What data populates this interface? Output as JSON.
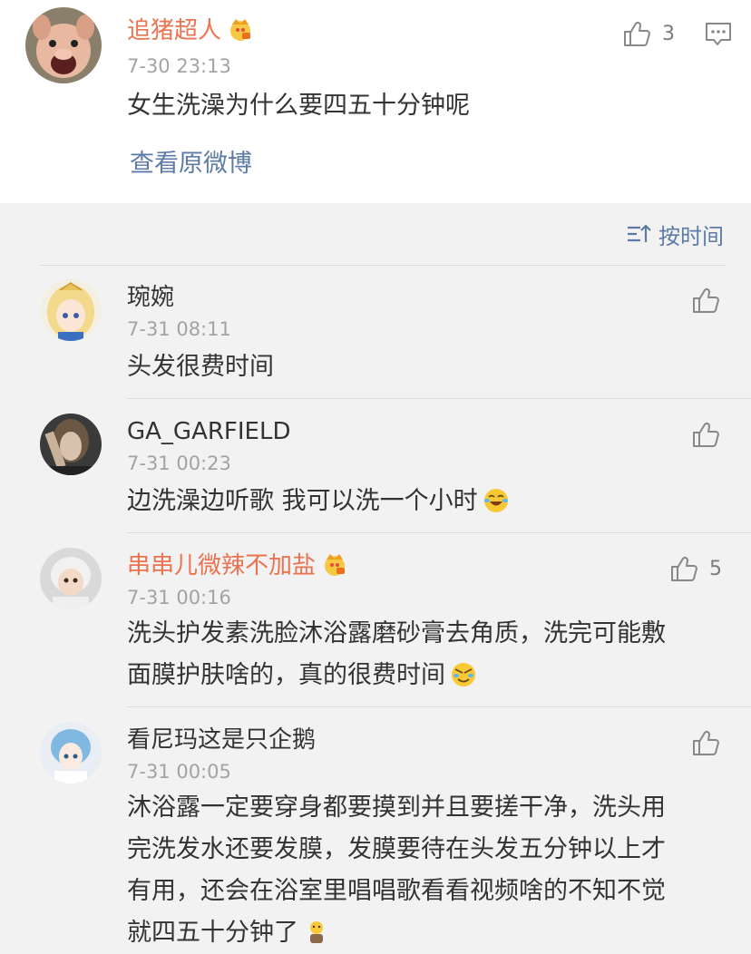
{
  "post": {
    "author": "追猪超人",
    "time": "7-30 23:13",
    "text": "女生洗澡为什么要四五十分钟呢",
    "like_count": "3",
    "view_original": "查看原微博"
  },
  "sort_label": "按时间",
  "comments": [
    {
      "name": "琬婉",
      "time": "7-31 08:11",
      "text": "头发很费时间",
      "likes": ""
    },
    {
      "name": "GA_GARFIELD",
      "time": "7-31 00:23",
      "text": "边洗澡边听歌 我可以洗一个小时",
      "likes": ""
    },
    {
      "name": "串串儿微辣不加盐",
      "time": "7-31 00:16",
      "text_line1": "洗头护发素洗脸沐浴露磨砂膏去角质，洗完可能敷",
      "text_line2": "面膜护肤啥的，真的很费时间",
      "likes": "5"
    },
    {
      "name": "看尼玛这是只企鹅",
      "time": "7-31 00:05",
      "text_line1": "沐浴露一定要穿身都要摸到并且要搓干净，洗头用",
      "text_line2": "完洗发水还要发膜，发膜要待在头发五分钟以上才",
      "text_line3": "有用，还会在浴室里唱唱歌看看视频啥的不知不觉",
      "text_line4": "就四五十分钟了",
      "likes": ""
    }
  ],
  "colors": {
    "vip_name": "#eb7350",
    "link": "#5d7ba6",
    "time": "#a3a3a3"
  },
  "icons": [
    "thumbs-up-icon",
    "comment-more-icon",
    "sort-icon",
    "vip-crown-icon",
    "laughing-crying-emoji",
    "facepalm-emoji",
    "shrug-emoji"
  ]
}
